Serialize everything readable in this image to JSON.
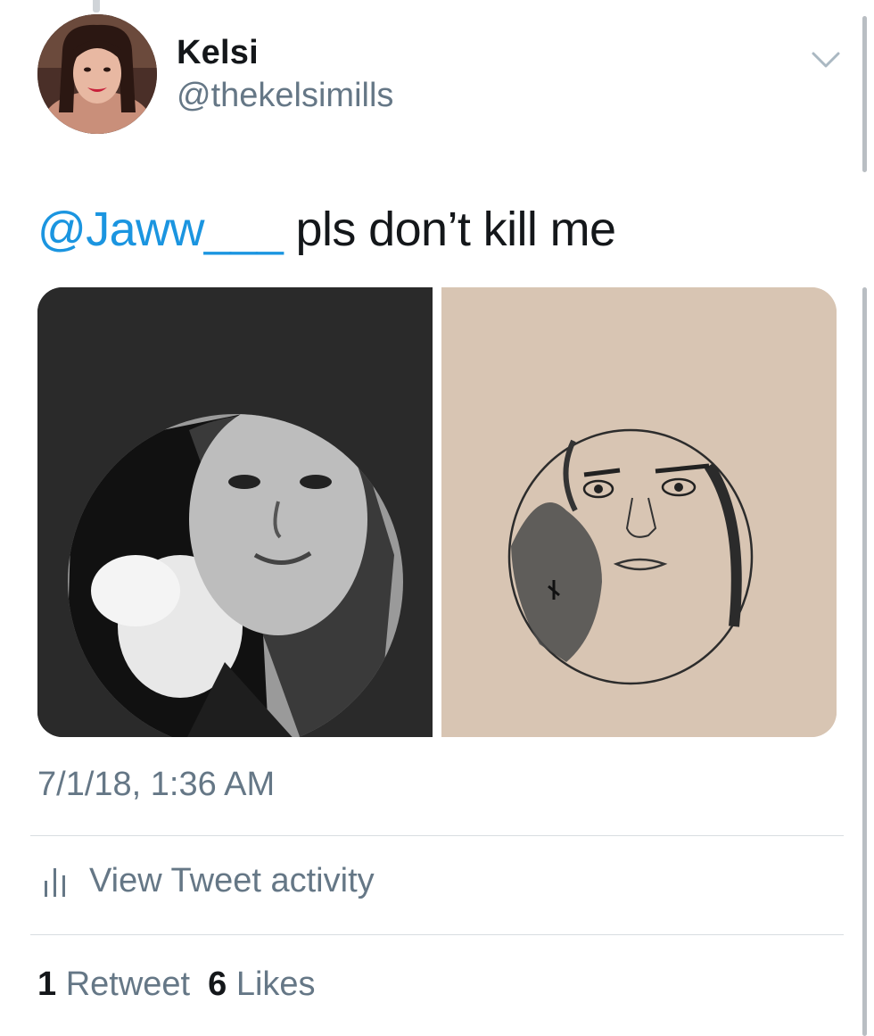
{
  "tweet": {
    "author_name": "Kelsi",
    "author_handle": "@thekelsimills",
    "mention": "@Jaww___",
    "text": " pls don’t kill me",
    "timestamp": "7/1/18, 1:36 AM"
  },
  "activity": {
    "label": "View Tweet activity",
    "icon": "bar-chart-icon"
  },
  "stats": {
    "retweets_count": "1",
    "retweets_label": "Retweet",
    "likes_count": "6",
    "likes_label": "Likes"
  },
  "colors": {
    "link": "#1b95e0",
    "secondary_text": "#657786",
    "primary_text": "#14171a",
    "divider": "#d8dde1"
  },
  "icons": {
    "caret": "chevron-down-icon"
  }
}
